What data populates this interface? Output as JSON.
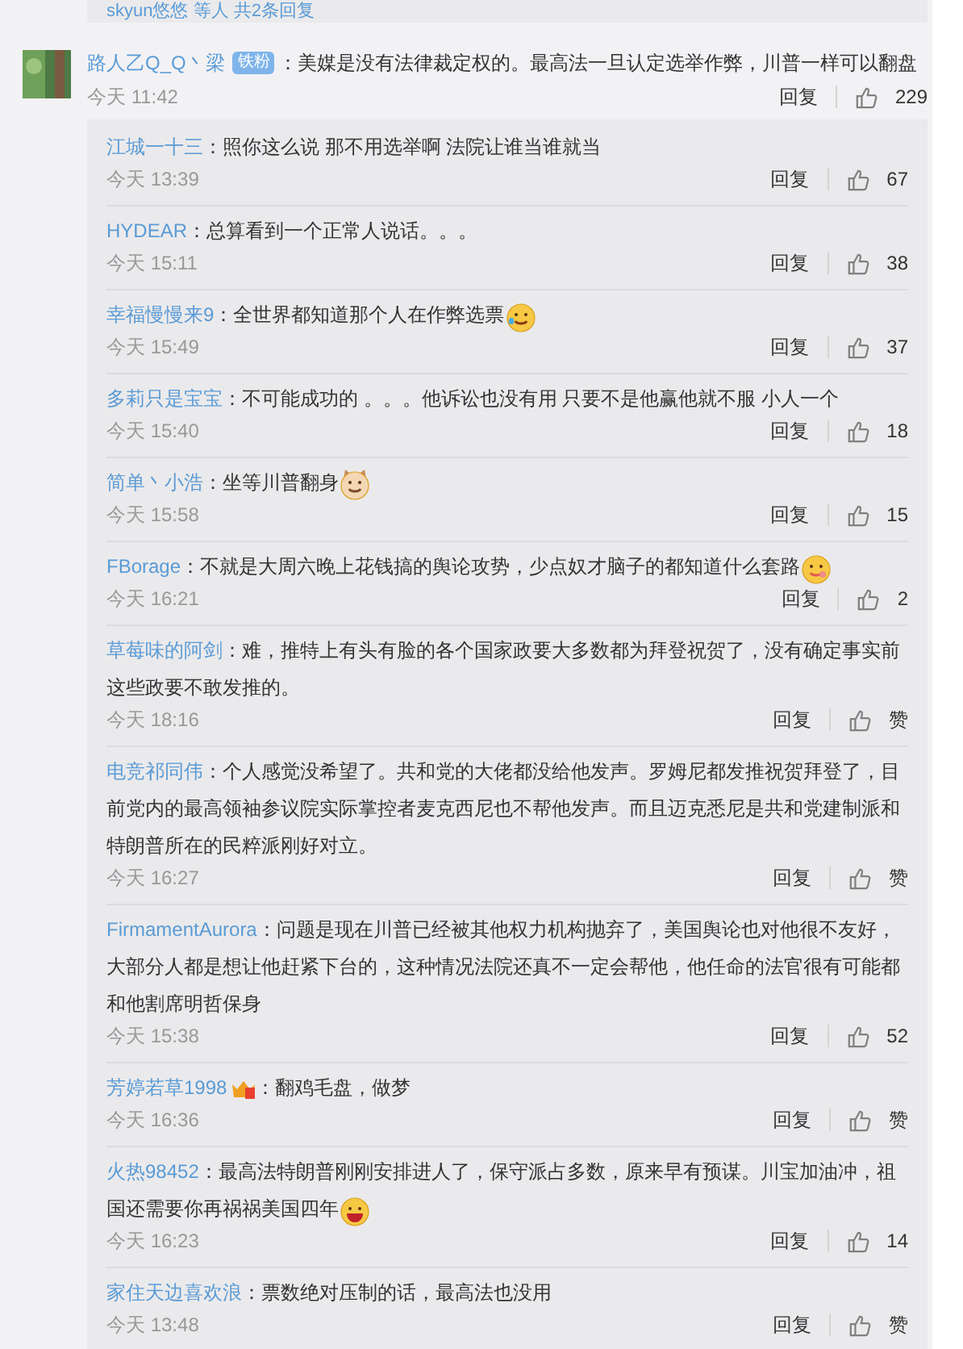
{
  "previous_thread": {
    "summary": "skyun悠悠 等人 共2条回复"
  },
  "comment": {
    "user": "路人乙Q_Q丶梁",
    "badge": "铁粉",
    "text": "：美媒是没有法律裁定权的。最高法一旦认定选举作弊，川普一样可以翻盘",
    "time": "今天 11:42",
    "reply_label": "回复",
    "likes": "229"
  },
  "replies": [
    {
      "user": "江城一十三",
      "text": "：照你这么说 那不用选举啊 法院让谁当谁就当",
      "time": "今天 13:39",
      "reply_label": "回复",
      "likes": "67"
    },
    {
      "user": "HYDEAR",
      "text": "：总算看到一个正常人说话。。。",
      "time": "今天 15:11",
      "reply_label": "回复",
      "likes": "38"
    },
    {
      "user": "幸福慢慢来9",
      "text": "：全世界都知道那个人在作弊选票",
      "emoji": {
        "kind": "tears"
      },
      "time": "今天 15:49",
      "reply_label": "回复",
      "likes": "37"
    },
    {
      "user": "多莉只是宝宝",
      "text": "：不可能成功的 。。。他诉讼也没有用 只要不是他赢他就不服 小人一个",
      "time": "今天 15:40",
      "reply_label": "回复",
      "likes": "18"
    },
    {
      "user": "简单丶小浩",
      "text": "：坐等川普翻身",
      "emoji": {
        "kind": "cat"
      },
      "time": "今天 15:58",
      "reply_label": "回复",
      "likes": "15"
    },
    {
      "user": "FBorage",
      "text": "：不就是大周六晚上花钱搞的舆论攻势，少点奴才脑子的都知道什么套路",
      "emoji": {
        "kind": "drool"
      },
      "time": "今天 16:21",
      "reply_label": "回复",
      "likes": "2"
    },
    {
      "user": "草莓味的阿剑",
      "text": "：难，推特上有头有脸的各个国家政要大多数都为拜登祝贺了，没有确定事实前这些政要不敢发推的。",
      "time": "今天 18:16",
      "reply_label": "回复",
      "likes": "赞"
    },
    {
      "user": "电竞祁同伟",
      "text": "：个人感觉没希望了。共和党的大佬都没给他发声。罗姆尼都发推祝贺拜登了，目前党内的最高领袖参议院实际掌控者麦克西尼也不帮他发声。而且迈克悉尼是共和党建制派和特朗普所在的民粹派刚好对立。",
      "time": "今天 16:27",
      "reply_label": "回复",
      "likes": "赞"
    },
    {
      "user": "FirmamentAurora",
      "text": "：问题是现在川普已经被其他权力机构抛弃了，美国舆论也对他很不友好，大部分人都是想让他赶紧下台的，这种情况法院还真不一定会帮他，他任命的法官很有可能都和他割席明哲保身",
      "time": "今天 15:38",
      "reply_label": "回复",
      "likes": "52"
    },
    {
      "user": "芳婷若草1998",
      "user_badge": true,
      "text": "：翻鸡毛盘，做梦",
      "time": "今天 16:36",
      "reply_label": "回复",
      "likes": "赞"
    },
    {
      "user": "火热98452",
      "text": "：最高法特朗普刚刚安排进人了，保守派占多数，原来早有预谋。川宝加油冲，祖国还需要你再祸祸美国四年",
      "emoji": {
        "kind": "grin"
      },
      "time": "今天 16:23",
      "reply_label": "回复",
      "likes": "14"
    },
    {
      "user": "家住天边喜欢浪",
      "text": "：票数绝对压制的话，最高法也没用",
      "time": "今天 13:48",
      "reply_label": "回复",
      "likes": "赞"
    }
  ]
}
